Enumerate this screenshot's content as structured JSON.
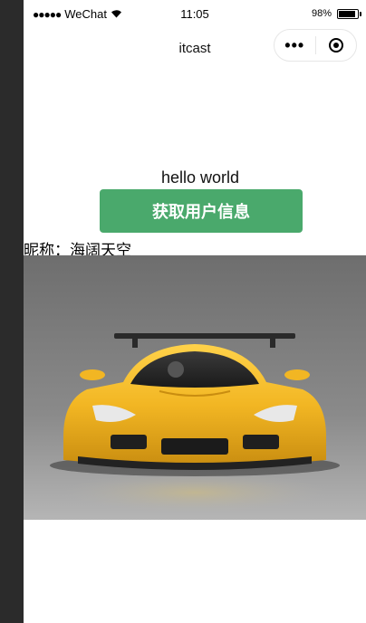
{
  "status_bar": {
    "signal": "●●●●●",
    "carrier": "WeChat",
    "wifi_icon": "wifi-icon",
    "time": "11:05",
    "battery_percent": "98%",
    "battery_level": 0.98
  },
  "nav": {
    "title": "itcast",
    "more_icon": "more-dots-icon",
    "more_glyph": "•••",
    "close_icon": "target-close-icon"
  },
  "content": {
    "greeting": "hello world",
    "get_user_info_label": "获取用户信息",
    "nickname_label": "昵称：",
    "nickname_value": "海阔天空",
    "image": "yellow-sports-car"
  },
  "colors": {
    "button_green": "#4aa96c",
    "sidebar_dark": "#2b2b2b",
    "car_yellow": "#f2b623",
    "backdrop_gray": "#7a7a7a"
  }
}
